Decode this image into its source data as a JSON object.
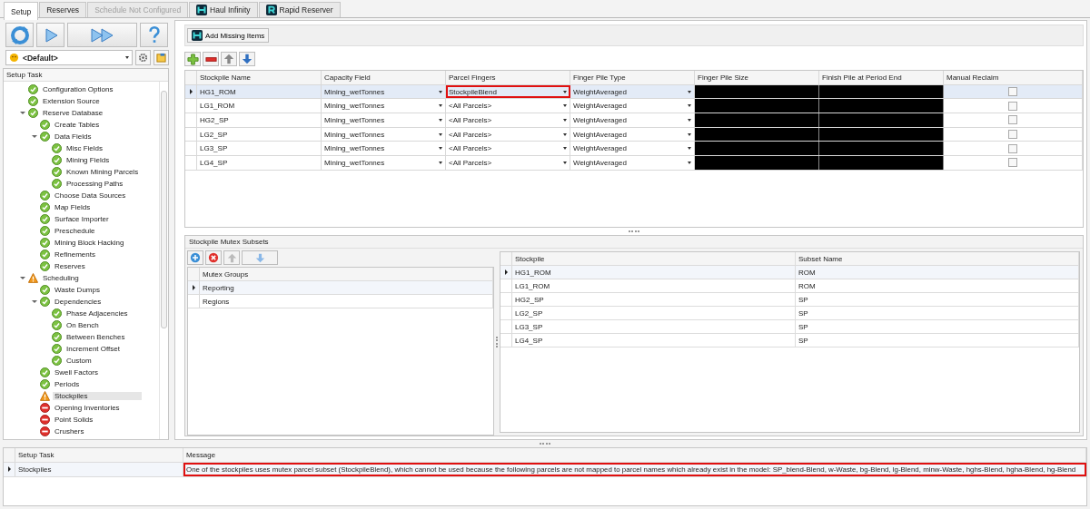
{
  "tabs": [
    {
      "label": "Setup",
      "selected": true,
      "disabled": false,
      "kind": "plain"
    },
    {
      "label": "Reserves",
      "selected": false,
      "disabled": false,
      "kind": "plain"
    },
    {
      "label": "Schedule Not Configured",
      "selected": false,
      "disabled": true,
      "kind": "plain"
    },
    {
      "label": "Haul Infinity",
      "selected": false,
      "disabled": false,
      "kind": "h-logo"
    },
    {
      "label": "Rapid Reserver",
      "selected": false,
      "disabled": false,
      "kind": "r-logo"
    }
  ],
  "sidebar": {
    "profile": "<Default>",
    "tree_header": "Setup Task",
    "items": [
      {
        "label": "Configuration Options",
        "kind": "ok",
        "selected": false
      },
      {
        "label": "Extension Source",
        "kind": "ok",
        "selected": false
      },
      {
        "label": "Reserve Database",
        "kind": "ok",
        "selected": false,
        "expanded": true,
        "children": [
          {
            "label": "Create Tables",
            "kind": "ok",
            "selected": false
          },
          {
            "label": "Data Fields",
            "kind": "ok",
            "selected": false,
            "expanded": true,
            "children": [
              {
                "label": "Misc Fields",
                "kind": "ok",
                "selected": false
              },
              {
                "label": "Mining Fields",
                "kind": "ok",
                "selected": false
              },
              {
                "label": "Known Mining Parcels",
                "kind": "ok",
                "selected": false
              },
              {
                "label": "Processing Paths",
                "kind": "ok",
                "selected": false
              }
            ]
          },
          {
            "label": "Choose Data Sources",
            "kind": "ok",
            "selected": false
          },
          {
            "label": "Map Fields",
            "kind": "ok",
            "selected": false
          },
          {
            "label": "Surface Importer",
            "kind": "ok",
            "selected": false
          },
          {
            "label": "Preschedule",
            "kind": "ok",
            "selected": false
          },
          {
            "label": "Mining Block Hacking",
            "kind": "ok",
            "selected": false
          },
          {
            "label": "Refinements",
            "kind": "ok",
            "selected": false
          },
          {
            "label": "Reserves",
            "kind": "ok",
            "selected": false
          }
        ]
      },
      {
        "label": "Scheduling",
        "kind": "warn",
        "selected": false,
        "expanded": true,
        "children": [
          {
            "label": "Waste Dumps",
            "kind": "ok",
            "selected": false
          },
          {
            "label": "Dependencies",
            "kind": "ok",
            "selected": false,
            "expanded": true,
            "children": [
              {
                "label": "Phase Adjacencies",
                "kind": "ok",
                "selected": false
              },
              {
                "label": "On Bench",
                "kind": "ok",
                "selected": false
              },
              {
                "label": "Between Benches",
                "kind": "ok",
                "selected": false
              },
              {
                "label": "Increment Offset",
                "kind": "ok",
                "selected": false
              },
              {
                "label": "Custom",
                "kind": "ok",
                "selected": false
              }
            ]
          },
          {
            "label": "Swell Factors",
            "kind": "ok",
            "selected": false
          },
          {
            "label": "Periods",
            "kind": "ok",
            "selected": false
          },
          {
            "label": "Stockpiles",
            "kind": "warn",
            "selected": true
          },
          {
            "label": "Opening Inventories",
            "kind": "error",
            "selected": false
          },
          {
            "label": "Point Solids",
            "kind": "error",
            "selected": false
          },
          {
            "label": "Crushers",
            "kind": "error",
            "selected": false
          }
        ]
      }
    ]
  },
  "add_missing_button": "Add Missing Items",
  "stockpile_grid": {
    "columns": [
      "Stockpile Name",
      "Capacity Field",
      "Parcel Fingers",
      "Finger Pile Type",
      "Finger Pile Size",
      "Finish Pile at Period End",
      "Manual Reclaim"
    ],
    "rows": [
      {
        "name": "HG1_ROM",
        "capacity": "Mining_wetTonnes",
        "parcels": "StockpileBlend",
        "pile_type": "WeightAveraged",
        "manual_reclaim": false,
        "selected": true,
        "flagged": true
      },
      {
        "name": "LG1_ROM",
        "capacity": "Mining_wetTonnes",
        "parcels": "<All Parcels>",
        "pile_type": "WeightAveraged",
        "manual_reclaim": false,
        "selected": false,
        "flagged": false
      },
      {
        "name": "HG2_SP",
        "capacity": "Mining_wetTonnes",
        "parcels": "<All Parcels>",
        "pile_type": "WeightAveraged",
        "manual_reclaim": false,
        "selected": false,
        "flagged": false
      },
      {
        "name": "LG2_SP",
        "capacity": "Mining_wetTonnes",
        "parcels": "<All Parcels>",
        "pile_type": "WeightAveraged",
        "manual_reclaim": false,
        "selected": false,
        "flagged": false
      },
      {
        "name": "LG3_SP",
        "capacity": "Mining_wetTonnes",
        "parcels": "<All Parcels>",
        "pile_type": "WeightAveraged",
        "manual_reclaim": false,
        "selected": false,
        "flagged": false
      },
      {
        "name": "LG4_SP",
        "capacity": "Mining_wetTonnes",
        "parcels": "<All Parcels>",
        "pile_type": "WeightAveraged",
        "manual_reclaim": false,
        "selected": false,
        "flagged": false
      }
    ]
  },
  "mutex": {
    "title": "Stockpile Mutex Subsets",
    "groups_header": "Mutex Groups",
    "groups": [
      {
        "label": "Reporting",
        "selected": true
      },
      {
        "label": "Regions",
        "selected": false
      }
    ],
    "columns": [
      "Stockpile",
      "Subset Name"
    ],
    "rows": [
      {
        "stockpile": "HG1_ROM",
        "subset": "ROM",
        "selected": true
      },
      {
        "stockpile": "LG1_ROM",
        "subset": "ROM",
        "selected": false
      },
      {
        "stockpile": "HG2_SP",
        "subset": "SP",
        "selected": false
      },
      {
        "stockpile": "LG2_SP",
        "subset": "SP",
        "selected": false
      },
      {
        "stockpile": "LG3_SP",
        "subset": "SP",
        "selected": false
      },
      {
        "stockpile": "LG4_SP",
        "subset": "SP",
        "selected": false
      }
    ]
  },
  "messages": {
    "columns": [
      "Setup Task",
      "Message"
    ],
    "rows": [
      {
        "task": "Stockpiles",
        "message": "One of the stockpiles uses mutex parcel subset (StockpileBlend), which cannot be used because the following parcels are not mapped to parcel names which already exist in the model: SP_blend-Blend, w-Waste, bg-Blend, lg-Blend, minw-Waste, hghs-Blend, hgha-Blend, hg-Blend",
        "selected": true,
        "flagged": true
      }
    ]
  }
}
